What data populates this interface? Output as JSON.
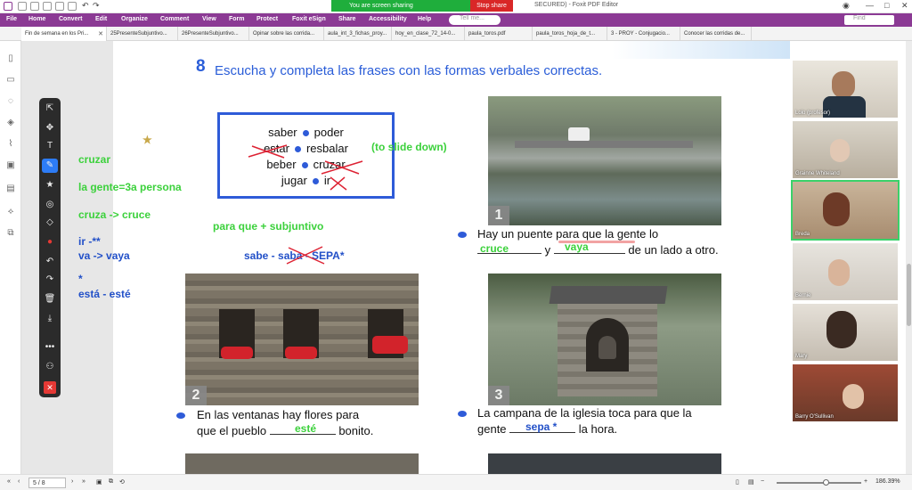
{
  "app": {
    "title": "SECURED) - Foxit PDF Editor",
    "share_status": "You are screen sharing",
    "stop_share": "Stop share"
  },
  "menu": {
    "items": [
      "File",
      "Home",
      "Convert",
      "Edit",
      "Organize",
      "Comment",
      "View",
      "Form",
      "Protect",
      "Foxit eSign",
      "Share",
      "Accessibility",
      "Help"
    ],
    "tell_me": "Tell me...",
    "find": "Find"
  },
  "tabs": [
    "Fin de semana en los Pri...",
    "25PresenteSubjuntivo...",
    "26PresenteSubjuntivo...",
    "Opinar sobre las corrida...",
    "aula_int_3_fichas_proy...",
    "hoy_en_clase_72_14-0...",
    "paula_toros.pdf",
    "paula_toros_hoja_de_t...",
    "3 - PROY - Conjugacio...",
    "Conocer las corridas de..."
  ],
  "exercise": {
    "number": "8",
    "heading": "Escucha y completa las frases con las formas verbales correctas."
  },
  "wordbox": {
    "rows": [
      [
        "saber",
        "poder"
      ],
      [
        "estar",
        "resbalar"
      ],
      [
        "beber",
        "cruzar"
      ],
      [
        "jugar",
        "ir"
      ]
    ]
  },
  "annotations": {
    "to_slide_down": "(to slide down)",
    "cruzar": "cruzar",
    "la_gente": "la gente=3a persona",
    "cruza_cruce": "cruza ->  cruce",
    "ir": "ir -**",
    "va_vaya": "va -> vaya",
    "star": "*",
    "esta_este": "está - esté",
    "para_que": "para que + subjuntivo",
    "sabe_seq": "sabe - saba - SEPA*",
    "ans_cruce": "cruce",
    "ans_vaya": "vaya",
    "ans_este": "esté",
    "ans_sepa": "sepa *"
  },
  "sentences": {
    "s1a": "Hay un puente para que la gente lo",
    "s1b": "y",
    "s1c": "de un lado a otro.",
    "s2a": "En las ventanas hay flores para",
    "s2b": "que el pueblo",
    "s2c": "bonito.",
    "s3a": "La campana de la iglesia toca para que la",
    "s3b": "gente",
    "s3c": "la hora."
  },
  "photos": {
    "n1": "1",
    "n2": "2",
    "n3": "3"
  },
  "participants": [
    "Lolo (profesor)",
    "Grainne Whiteland",
    "Breda",
    "Bernie",
    "Mary",
    "Barry O'Sullivan"
  ],
  "status": {
    "page": "5 / 8",
    "zoom": "186.39%"
  },
  "colors": {
    "accent": "#8b3a94",
    "annotation_green": "#3cd13c",
    "annotation_blue": "#2250c8",
    "heading_blue": "#2a5dd8"
  }
}
